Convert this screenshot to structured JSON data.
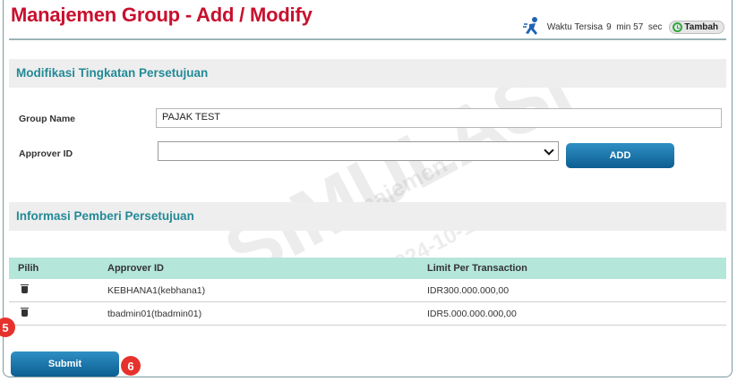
{
  "header": {
    "title": "Manajemen Group - Add / Modify",
    "timer_label": "Waktu Tersisa",
    "timer_value": "9  min 57  sec",
    "extend_label": "Tambah"
  },
  "section_modify": {
    "title": "Modifikasi Tingkatan Persetujuan"
  },
  "form": {
    "group_name_label": "Group Name",
    "group_name_value": "PAJAK TEST",
    "approver_label": "Approver ID",
    "approver_selected": "",
    "add_label": "ADD"
  },
  "section_info": {
    "title": "Informasi Pemberi Persetujuan"
  },
  "table": {
    "headers": [
      "Pilih",
      "Approver ID",
      "Limit Per Transaction"
    ],
    "rows": [
      {
        "approver": "KEBHANA1(kebhana1)",
        "limit": "IDR300.000.000,00"
      },
      {
        "approver": "tbadmin01(tbadmin01)",
        "limit": "IDR5.000.000.000,00"
      }
    ]
  },
  "submit_label": "Submit",
  "badges": {
    "step5": "5",
    "step6": "6"
  },
  "watermark": {
    "main": "SIMULASI",
    "sub": "Manajemen",
    "date": "2024-10-18"
  },
  "colors": {
    "title": "#c8102e",
    "section_title": "#238a96",
    "table_header": "#b4e6da",
    "button": "#0c5e91",
    "badge": "#e5322d"
  }
}
